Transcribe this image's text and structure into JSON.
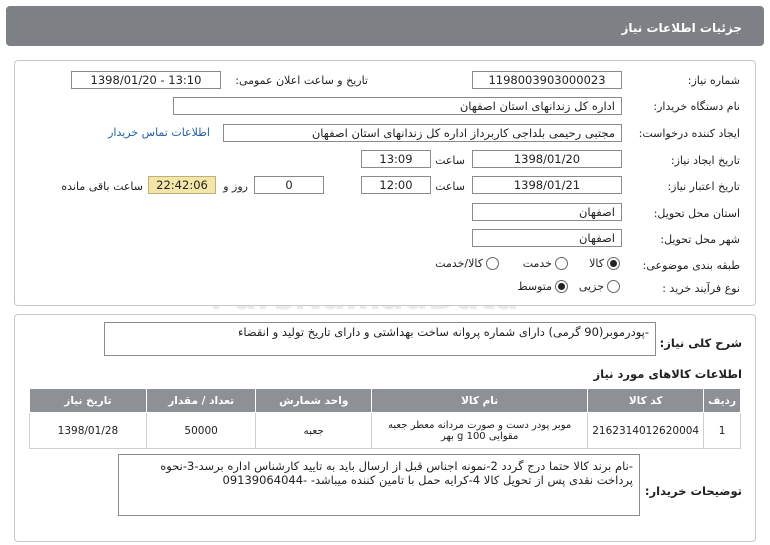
{
  "header": {
    "title": "جزئیات اطلاعات نیاز"
  },
  "fields": {
    "need_number_label": "شماره نیاز:",
    "need_number": "1198003903000023",
    "announce_label": "تاریخ و ساعت اعلان عمومی:",
    "announce_value": "1398/01/20 - 13:10",
    "buyer_org_label": "نام دستگاه خریدار:",
    "buyer_org": "اداره کل زندانهای استان اصفهان",
    "requester_label": "ایجاد کننده درخواست:",
    "requester": "مجتبی رحیمی بلداجی کاربرداز اداره کل زندانهای استان اصفهان",
    "contact_link": "اطلاعات تماس خریدار",
    "created_label": "تاریخ ایجاد نیاز:",
    "created_date": "1398/01/20",
    "time_label": "ساعت",
    "created_time": "13:09",
    "valid_label": "تاریخ اعتبار نیاز:",
    "valid_date": "1398/01/21",
    "valid_time": "12:00",
    "days": "0",
    "days_label": "روز و",
    "remaining": "22:42:06",
    "remaining_label": "ساعت باقی مانده",
    "province_label": "استان محل تحویل:",
    "province": "اصفهان",
    "city_label": "شهر محل تحویل:",
    "city": "اصفهان",
    "category_label": "طبقه بندی موضوعی:",
    "category_options": [
      "کالا",
      "خدمت",
      "کالا/خدمت"
    ],
    "category_selected": "کالا",
    "process_label": "نوع فرآیند خرید :",
    "process_options": [
      "جزیی",
      "متوسط"
    ],
    "process_selected": "متوسط"
  },
  "summary": {
    "label": "شرح کلی نیاز:",
    "text": "-پودرموبر(90 گرمی) دارای شماره پروانه ساخت بهداشتی و دارای تاریخ تولید و انقضاء"
  },
  "goods": {
    "title": "اطلاعات کالاهای مورد نیاز",
    "columns": [
      "ردیف",
      "کد کالا",
      "نام کالا",
      "واحد شمارش",
      "تعداد / مقدار",
      "تاریخ نیاز"
    ],
    "rows": [
      [
        "1",
        "2162314012620004",
        "موبر پودر دست و صورت مردانه معطر جعبه مقوایی 100 g بهر",
        "جعبه",
        "50000",
        "1398/01/28"
      ]
    ]
  },
  "notes": {
    "label": "توضیحات خریدار:",
    "text": "-نام برند کالا حتما درج گردد 2-نمونه اجناس قبل از ارسال باید به تایید کارشناس اداره برسد-3-نحوه پرداخت نقدی پس از تحویل کالا 4-کرایه حمل با تامین کننده میباشد- -09139064044"
  },
  "watermark": {
    "line1": "ParsNamadData",
    "line2": "مرکز فراوری اطلاعات پارس نماد داده",
    "line3": "پایگاه اطلاع رسانی مناقصه ومزایده",
    "phone": "۰۲۱-۸۸۳۴۹۶۷۰"
  },
  "colors": {
    "header_bg": "#7d8186",
    "table_header_bg": "#8d9196",
    "remaining_bg": "#f3e6a6",
    "link": "#1f5fae"
  }
}
